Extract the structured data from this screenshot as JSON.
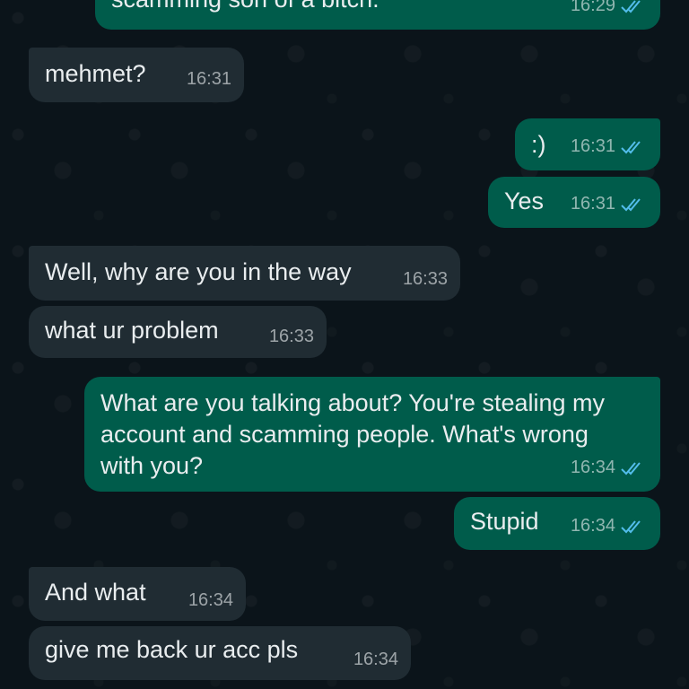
{
  "colors": {
    "background": "#0b141a",
    "incoming_bubble": "#202c33",
    "outgoing_bubble": "#005c4b",
    "read_ticks": "#53bdeb"
  },
  "messages": [
    {
      "direction": "out",
      "text": "scamming son of a bitch.",
      "time": "16:29",
      "status_icon": "double-check-read-icon"
    },
    {
      "direction": "in",
      "text": "mehmet?",
      "time": "16:31"
    },
    {
      "direction": "out",
      "text": ":)",
      "time": "16:31",
      "status_icon": "double-check-read-icon"
    },
    {
      "direction": "out",
      "text": "Yes",
      "time": "16:31",
      "status_icon": "double-check-read-icon"
    },
    {
      "direction": "in",
      "text": "Well, why are you in the way",
      "time": "16:33"
    },
    {
      "direction": "in",
      "text": "what ur problem",
      "time": "16:33"
    },
    {
      "direction": "out",
      "text": "What are you talking about? You're stealing my account and scamming people. What's wrong with you?",
      "time": "16:34",
      "status_icon": "double-check-read-icon"
    },
    {
      "direction": "out",
      "text": "Stupid",
      "time": "16:34",
      "status_icon": "double-check-read-icon"
    },
    {
      "direction": "in",
      "text": "And what",
      "time": "16:34"
    },
    {
      "direction": "in",
      "text": "give me back ur acc pls",
      "time": "16:34"
    }
  ]
}
